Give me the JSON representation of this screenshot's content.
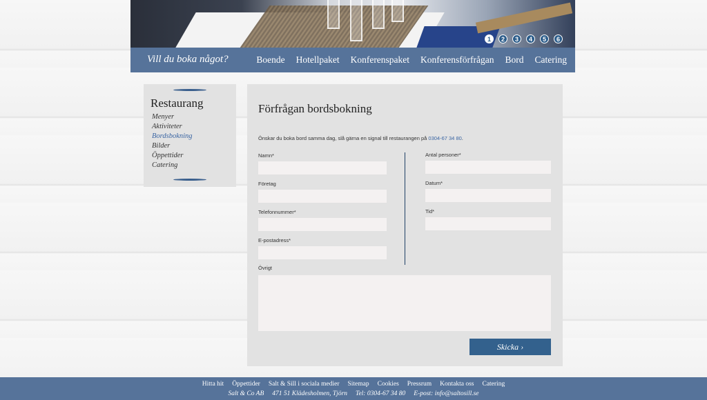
{
  "hero": {
    "slides": [
      "1",
      "2",
      "3",
      "4",
      "5",
      "6"
    ],
    "active_slide": 0
  },
  "nav": {
    "tagline": "Vill du boka något?",
    "links": [
      "Boende",
      "Hotellpaket",
      "Konferenspaket",
      "Konferensförfrågan",
      "Bord",
      "Catering"
    ]
  },
  "sidebar": {
    "title": "Restaurang",
    "items": [
      "Menyer",
      "Aktiviteter",
      "Bordsbokning",
      "Bilder",
      "Öppettider",
      "Catering"
    ],
    "active_index": 2
  },
  "form": {
    "title": "Förfrågan bordsbokning",
    "intro_text": "Önskar du boka bord samma dag, slå gärna en signal till restaurangen på ",
    "intro_phone": "0304-67 34 80",
    "intro_end": ".",
    "left_fields": [
      {
        "label": "Namn*",
        "value": ""
      },
      {
        "label": "Företag",
        "value": ""
      },
      {
        "label": "Telefonnummer*",
        "value": ""
      },
      {
        "label": "E-postadress*",
        "value": ""
      }
    ],
    "right_fields": [
      {
        "label": "Antal personer*",
        "value": ""
      },
      {
        "label": "Datum*",
        "value": ""
      },
      {
        "label": "Tid*",
        "value": ""
      }
    ],
    "other_label": "Övrigt",
    "submit_label": "Skicka ›"
  },
  "footer": {
    "links": [
      "Hitta hit",
      "Öppettider",
      "Salt & Sill i sociala medier",
      "Sitemap",
      "Cookies",
      "Pressrum",
      "Kontakta oss",
      "Catering"
    ],
    "company": "Salt & Co AB",
    "address": "471 51 Klädesholmen, Tjörn",
    "phone": "Tel: 0304-67 34 80",
    "email": "E-post: info@saltosill.se"
  },
  "colors": {
    "nav_bg": "#56739a",
    "accent": "#33618d",
    "link": "#3a65a3"
  }
}
